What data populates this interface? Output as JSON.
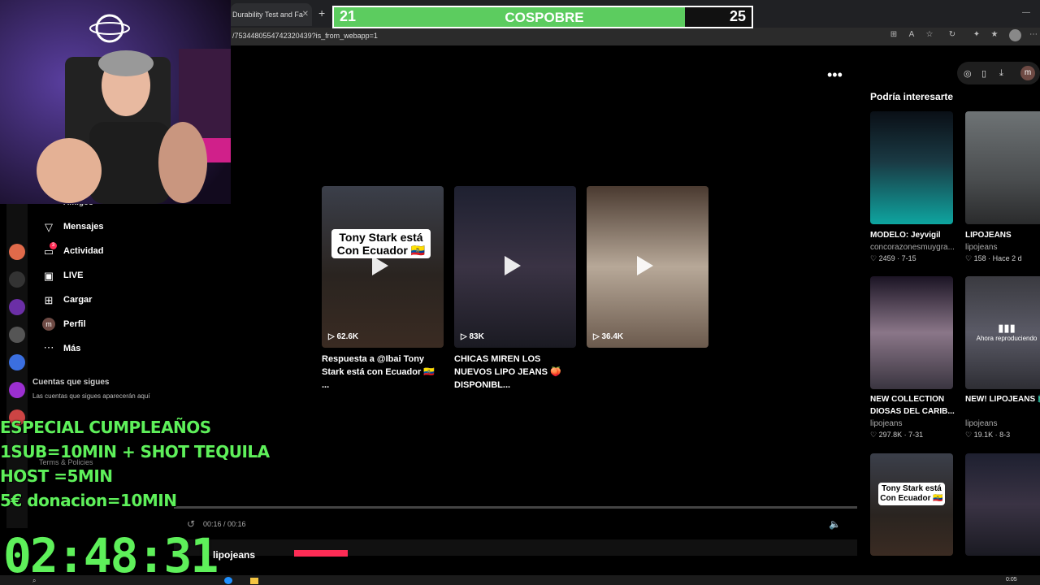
{
  "browser": {
    "tab_title": "Durability Test and Fa",
    "url": "/7534480554742320439?is_from_webapp=1"
  },
  "vs_bar": {
    "left_score": "21",
    "title": "COSPOBRE",
    "right_score": "25",
    "left_fraction": 0.84,
    "fill_color": "#5ccc5f"
  },
  "main": {
    "videos": [
      {
        "caption": "Tony Stark está Con Ecuador 🇪🇨",
        "views": "62.6K",
        "title": "Respuesta a @Ibai Tony Stark está con Ecuador 🇪🇨 ..."
      },
      {
        "caption": "",
        "views": "83K",
        "title": "CHICAS MIREN LOS NUEVOS LIPO JEANS 🍑 DISPONIBL..."
      },
      {
        "caption": "",
        "views": "36.4K",
        "title": ""
      }
    ]
  },
  "rail": {
    "title": "Podría interesarte",
    "items": [
      {
        "title": "MODELO: Jeyvigil",
        "author": "concorazonesmuygra...",
        "likes": "2459",
        "date": "7-15"
      },
      {
        "title": "LIPOJEANS",
        "author": "lipojeans",
        "likes": "158",
        "date": "Hace 2 d"
      },
      {
        "title": "NEW COLLECTION DIOSAS DEL CARIB...",
        "author": "lipojeans",
        "likes": "297.8K",
        "date": "7-31"
      },
      {
        "title": "NEW! LIPOJEANS 🛍️",
        "author": "lipojeans",
        "likes": "19.1K",
        "date": "8-3",
        "overlay": "Ahora reproduciendo"
      },
      {
        "caption": "Tony Stark está Con Ecuador 🇪🇨"
      },
      {}
    ]
  },
  "nav": {
    "items": [
      {
        "icon": "paper-plane-icon",
        "label": "Mensajes"
      },
      {
        "icon": "inbox-icon",
        "label": "Actividad",
        "badge": "3"
      },
      {
        "icon": "live-tv-icon",
        "label": "LIVE"
      },
      {
        "icon": "upload-icon",
        "label": "Cargar"
      },
      {
        "icon": "avatar-icon",
        "label": "Perfil",
        "avatar_letter": "m"
      },
      {
        "icon": "more-icon",
        "label": "Más"
      }
    ],
    "partial_top_label": "Amigos",
    "following_title": "Cuentas que sigues",
    "following_hint": "Las cuentas que sigues aparecerán aquí",
    "footer_link": "Terms & Policies"
  },
  "player": {
    "time": "00:16 / 00:16",
    "author": "lipojeans"
  },
  "overlay": {
    "promo_lines": [
      "ESPECIAL CUMPLEAÑOS",
      "1SUB=10MIN + SHOT TEQUILA",
      "HOST =5MIN",
      "5€ donacion=10MIN"
    ],
    "timer": "02:48:31"
  },
  "taskbar": {
    "clock": "0:05"
  }
}
